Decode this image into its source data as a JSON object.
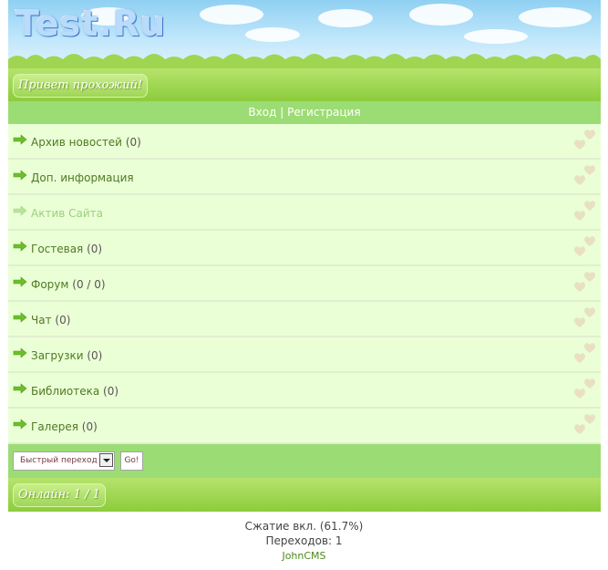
{
  "header": {
    "logo_text": "Test.Ru"
  },
  "greeting": {
    "text": "Привет прохожий!"
  },
  "auth": {
    "login": "Вход",
    "separator": "|",
    "register": "Регистрация"
  },
  "menu": [
    {
      "label": "Архив новостей",
      "count": "(0)",
      "icon": "arrow-right-icon"
    },
    {
      "label": "Доп. информация",
      "count": "",
      "icon": "arrow-right-icon"
    },
    {
      "label": "Актив Сайта",
      "count": "",
      "icon": "arrow-right-icon",
      "dimmed": true
    },
    {
      "label": "Гостевая",
      "count": "(0)",
      "icon": "arrow-right-icon"
    },
    {
      "label": "Форум",
      "count": "(0 / 0)",
      "icon": "arrow-right-icon"
    },
    {
      "label": "Чат",
      "count": "(0)",
      "icon": "arrow-right-icon"
    },
    {
      "label": "Загрузки",
      "count": "(0)",
      "icon": "arrow-right-icon"
    },
    {
      "label": "Библиотека",
      "count": "(0)",
      "icon": "arrow-right-icon"
    },
    {
      "label": "Галерея",
      "count": "(0)",
      "icon": "arrow-right-icon"
    }
  ],
  "quick_jump": {
    "selected": "Быстрый переход",
    "go_label": "Go!"
  },
  "online": {
    "text": "Онлайн: 1 / 1"
  },
  "footer": {
    "compression": "Сжатие вкл. (61.7%)",
    "transitions": "Переходов: 1",
    "engine": "JohnCMS"
  },
  "colors": {
    "accent_green": "#8ccc3c",
    "bar_green": "#9cdc74",
    "row_bg": "#ebffd6",
    "link": "#4e7a22"
  }
}
